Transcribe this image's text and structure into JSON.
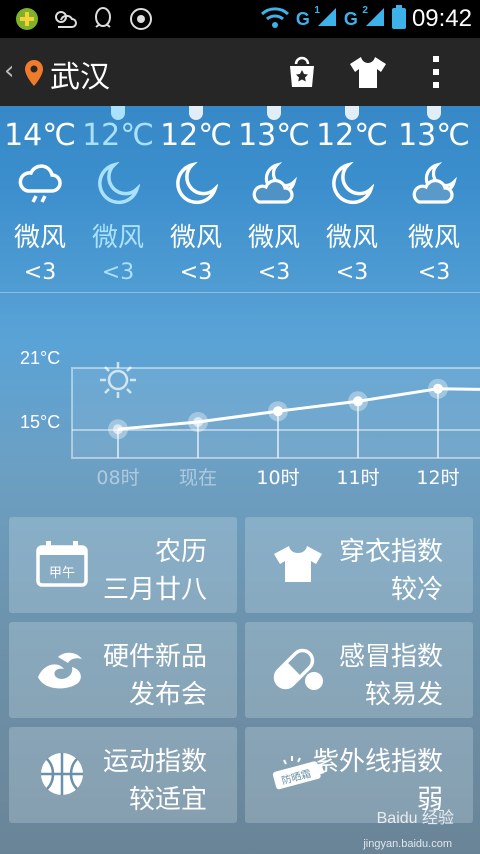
{
  "status_bar": {
    "time": "09:42",
    "sim1": "G",
    "sim1_tag": "1",
    "sim2": "G",
    "sim2_tag": "2"
  },
  "app_bar": {
    "city": "武汉"
  },
  "hourly": [
    {
      "temp": "14℃",
      "wind": "微风",
      "level": "<3",
      "icon": "cloud-rain-icon",
      "active": false
    },
    {
      "temp": "12℃",
      "wind": "微风",
      "level": "<3",
      "icon": "moon-icon",
      "active": true
    },
    {
      "temp": "12℃",
      "wind": "微风",
      "level": "<3",
      "icon": "moon-icon",
      "active": false
    },
    {
      "temp": "13℃",
      "wind": "微风",
      "level": "<3",
      "icon": "moon-cloud-icon",
      "active": false
    },
    {
      "temp": "12℃",
      "wind": "微风",
      "level": "<3",
      "icon": "moon-icon",
      "active": false
    },
    {
      "temp": "13℃",
      "wind": "微风",
      "level": "<3",
      "icon": "moon-cloud-icon",
      "active": false
    }
  ],
  "chart_data": {
    "type": "line",
    "y_ticks": [
      "21°C",
      "15°C"
    ],
    "categories": [
      "08时",
      "现在",
      "10时",
      "11时",
      "12时"
    ],
    "values": [
      15.2,
      16.0,
      17.2,
      18.3,
      19.7
    ],
    "ylim": [
      12,
      22
    ]
  },
  "tiles": [
    {
      "line1": "农历",
      "line2": "三月廿八",
      "icon": "calendar-icon",
      "icon_text": "甲午"
    },
    {
      "line1": "穿衣指数",
      "line2": "较冷",
      "icon": "tshirt-icon"
    },
    {
      "line1": "硬件新品",
      "line2": "发布会",
      "icon": "cloud-swirl-icon"
    },
    {
      "line1": "感冒指数",
      "line2": "较易发",
      "icon": "pill-icon"
    },
    {
      "line1": "运动指数",
      "line2": "较适宜",
      "icon": "basketball-icon"
    },
    {
      "line1": "紫外线指数",
      "line2": "弱",
      "icon": "sunscreen-icon",
      "icon_text": "防晒霜"
    }
  ],
  "watermark": {
    "brand": "Baidu 经验",
    "url": "jingyan.baidu.com"
  }
}
